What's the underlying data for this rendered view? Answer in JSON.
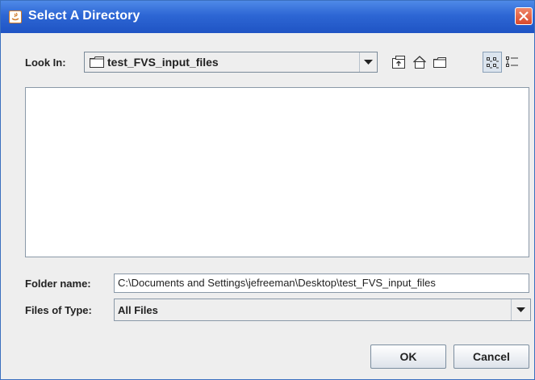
{
  "window": {
    "title": "Select A Directory"
  },
  "look_in": {
    "label": "Look In:",
    "value": "test_FVS_input_files"
  },
  "toolbar": {
    "icons": [
      "up-one-level-icon",
      "home-icon",
      "new-folder-icon",
      "list-view-icon",
      "details-view-icon"
    ],
    "selected_view": "list-view"
  },
  "folder_name": {
    "label": "Folder name:",
    "value": "C:\\Documents and Settings\\jefreeman\\Desktop\\test_FVS_input_files"
  },
  "files_of_type": {
    "label": "Files of Type:",
    "value": "All Files"
  },
  "buttons": {
    "ok": "OK",
    "cancel": "Cancel"
  },
  "colors": {
    "titlebar": "#2d66d4",
    "close": "#d9482c",
    "background": "#eeeeee"
  }
}
